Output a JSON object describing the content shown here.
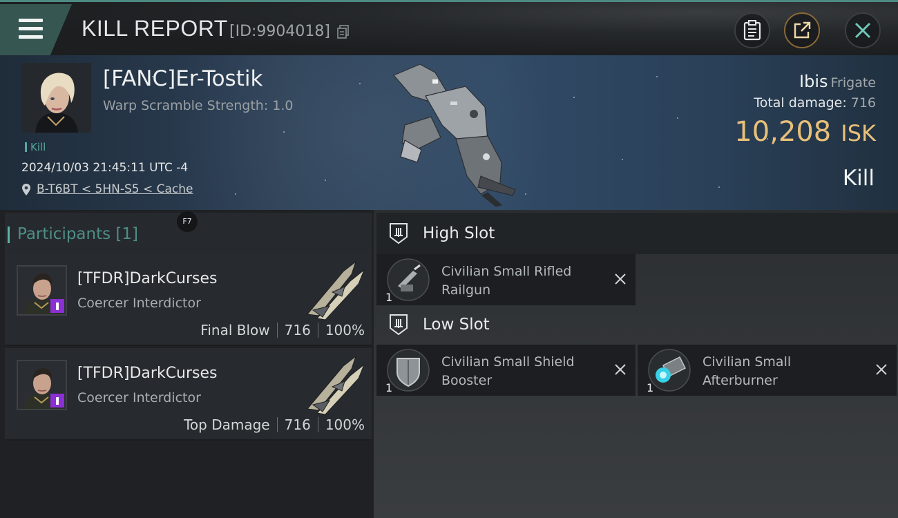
{
  "topbar": {
    "title": "KILL REPORT",
    "report_id": "[ID:9904018]",
    "icons": [
      "menu-icon",
      "copy-icon",
      "clipboard-icon",
      "share-icon",
      "close-icon"
    ]
  },
  "victim": {
    "pilot": "[FANC]Er-Tostik",
    "warp_scramble": "Warp Scramble Strength: 1.0",
    "tag": "Kill",
    "datetime": "2024/10/03 21:45:11 UTC -4",
    "location": "B-T6BT < 5HN-S5 < Cache",
    "ship_name": "Ibis",
    "ship_class": "Frigate",
    "total_damage_label": "Total damage:",
    "total_damage": "716",
    "isk_value": "10,208",
    "isk_unit": "ISK",
    "result": "Kill"
  },
  "participants": {
    "header": "Participants [1]",
    "hotkey": "F7",
    "items": [
      {
        "name": "[TFDR]DarkCurses",
        "ship": "Coercer Interdictor",
        "role": "Final Blow",
        "damage": "716",
        "percent": "100%"
      },
      {
        "name": "[TFDR]DarkCurses",
        "ship": "Coercer Interdictor",
        "role": "Top Damage",
        "damage": "716",
        "percent": "100%"
      }
    ]
  },
  "fittings": {
    "high_slot": {
      "label": "High Slot",
      "modules": [
        {
          "name": "Civilian Small Rifled Railgun",
          "qty": "1",
          "icon": "railgun-icon"
        }
      ]
    },
    "low_slot": {
      "label": "Low Slot",
      "modules": [
        {
          "name": "Civilian Small Shield Booster",
          "qty": "1",
          "icon": "shield-booster-icon"
        },
        {
          "name": "Civilian Small Afterburner",
          "qty": "1",
          "icon": "afterburner-icon"
        }
      ]
    }
  },
  "colors": {
    "accent_teal": "#5fb3a5",
    "isk_gold": "#e8c07a",
    "faction_purple": "#8c2fd4"
  }
}
